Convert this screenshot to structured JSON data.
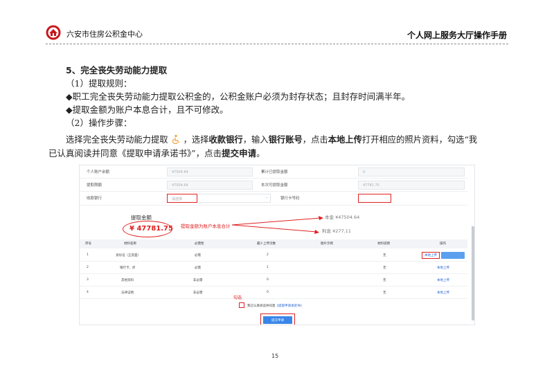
{
  "header": {
    "org_name": "六安市住房公积金中心",
    "manual_title": "个人网上服务大厅操作手册"
  },
  "section": {
    "title": "5、完全丧失劳动能力提取",
    "rules_heading": "（1）提取规则：",
    "rule_1": "◆职工完全丧失劳动能力提取公积金的，公积金账户必须为封存状态；且封存时间满半年。",
    "rule_2": "◆提取金额为账户本息合计，且不可修改。",
    "steps_heading": "（2）操作步骤：",
    "step_a1": "选择完全丧失劳动能力提取",
    "step_a2": "，选择",
    "step_b_bold1": "收款银行",
    "step_c": "，输入",
    "step_d_bold2": "银行账号",
    "step_e": "，点击",
    "step_f_bold3": "本地上传",
    "step_g": "打开相应的照片资料，勾选“我",
    "step_line2a": "已认真阅读并同意《提取申请承诺书》”，点击",
    "step_line2_bold": "提交申请",
    "step_line2c": "。"
  },
  "screenshot": {
    "fields": {
      "row1_left_label": "个人账户余额",
      "row1_left_value": "47504.64",
      "row1_right_label": "累计已提取金额",
      "row1_right_value": "0",
      "row2_left_label": "提取限额",
      "row2_left_value": "47504.64",
      "row2_right_label": "本次可提取金额",
      "row2_right_value": "47781.75",
      "row3_left_label": "收款银行",
      "row3_left_value": "请选择",
      "row3_right_label": "银行卡号码"
    },
    "amount_title": "提取金额",
    "amount_value": "¥ 47781.75",
    "amount_note": "提取金额为账户本息合计",
    "principal": "本金 ¥47504.64",
    "interest": "利息 ¥277.11",
    "table": {
      "headers": [
        "序号",
        "材料名称",
        "必需性",
        "最少上传页数",
        "图片示例",
        "材料说明",
        "操作"
      ],
      "rows": [
        {
          "no": "1",
          "name": "身份证（正反面）",
          "need": "必需",
          "pages": "2",
          "desc": "无",
          "action": "本地上传"
        },
        {
          "no": "2",
          "name": "银行卡、折",
          "need": "必需",
          "pages": "1",
          "desc": "无",
          "action": "本地上传"
        },
        {
          "no": "3",
          "name": "其他资料",
          "need": "非必需",
          "pages": "0",
          "desc": "无",
          "action": "本地上传"
        },
        {
          "no": "4",
          "name": "法律证明",
          "need": "非必需",
          "pages": "0",
          "desc": "无",
          "action": "本地上传"
        }
      ]
    },
    "check_label": "勾选",
    "agree_text": "我已认真阅读并同意",
    "agree_link": "《提取申请承诺书》",
    "submit_label": "提交申请"
  },
  "page_number": "15",
  "colors": {
    "annotation_red": "#e02020",
    "link_blue": "#1f5fd1",
    "button_blue": "#3a86e8"
  }
}
